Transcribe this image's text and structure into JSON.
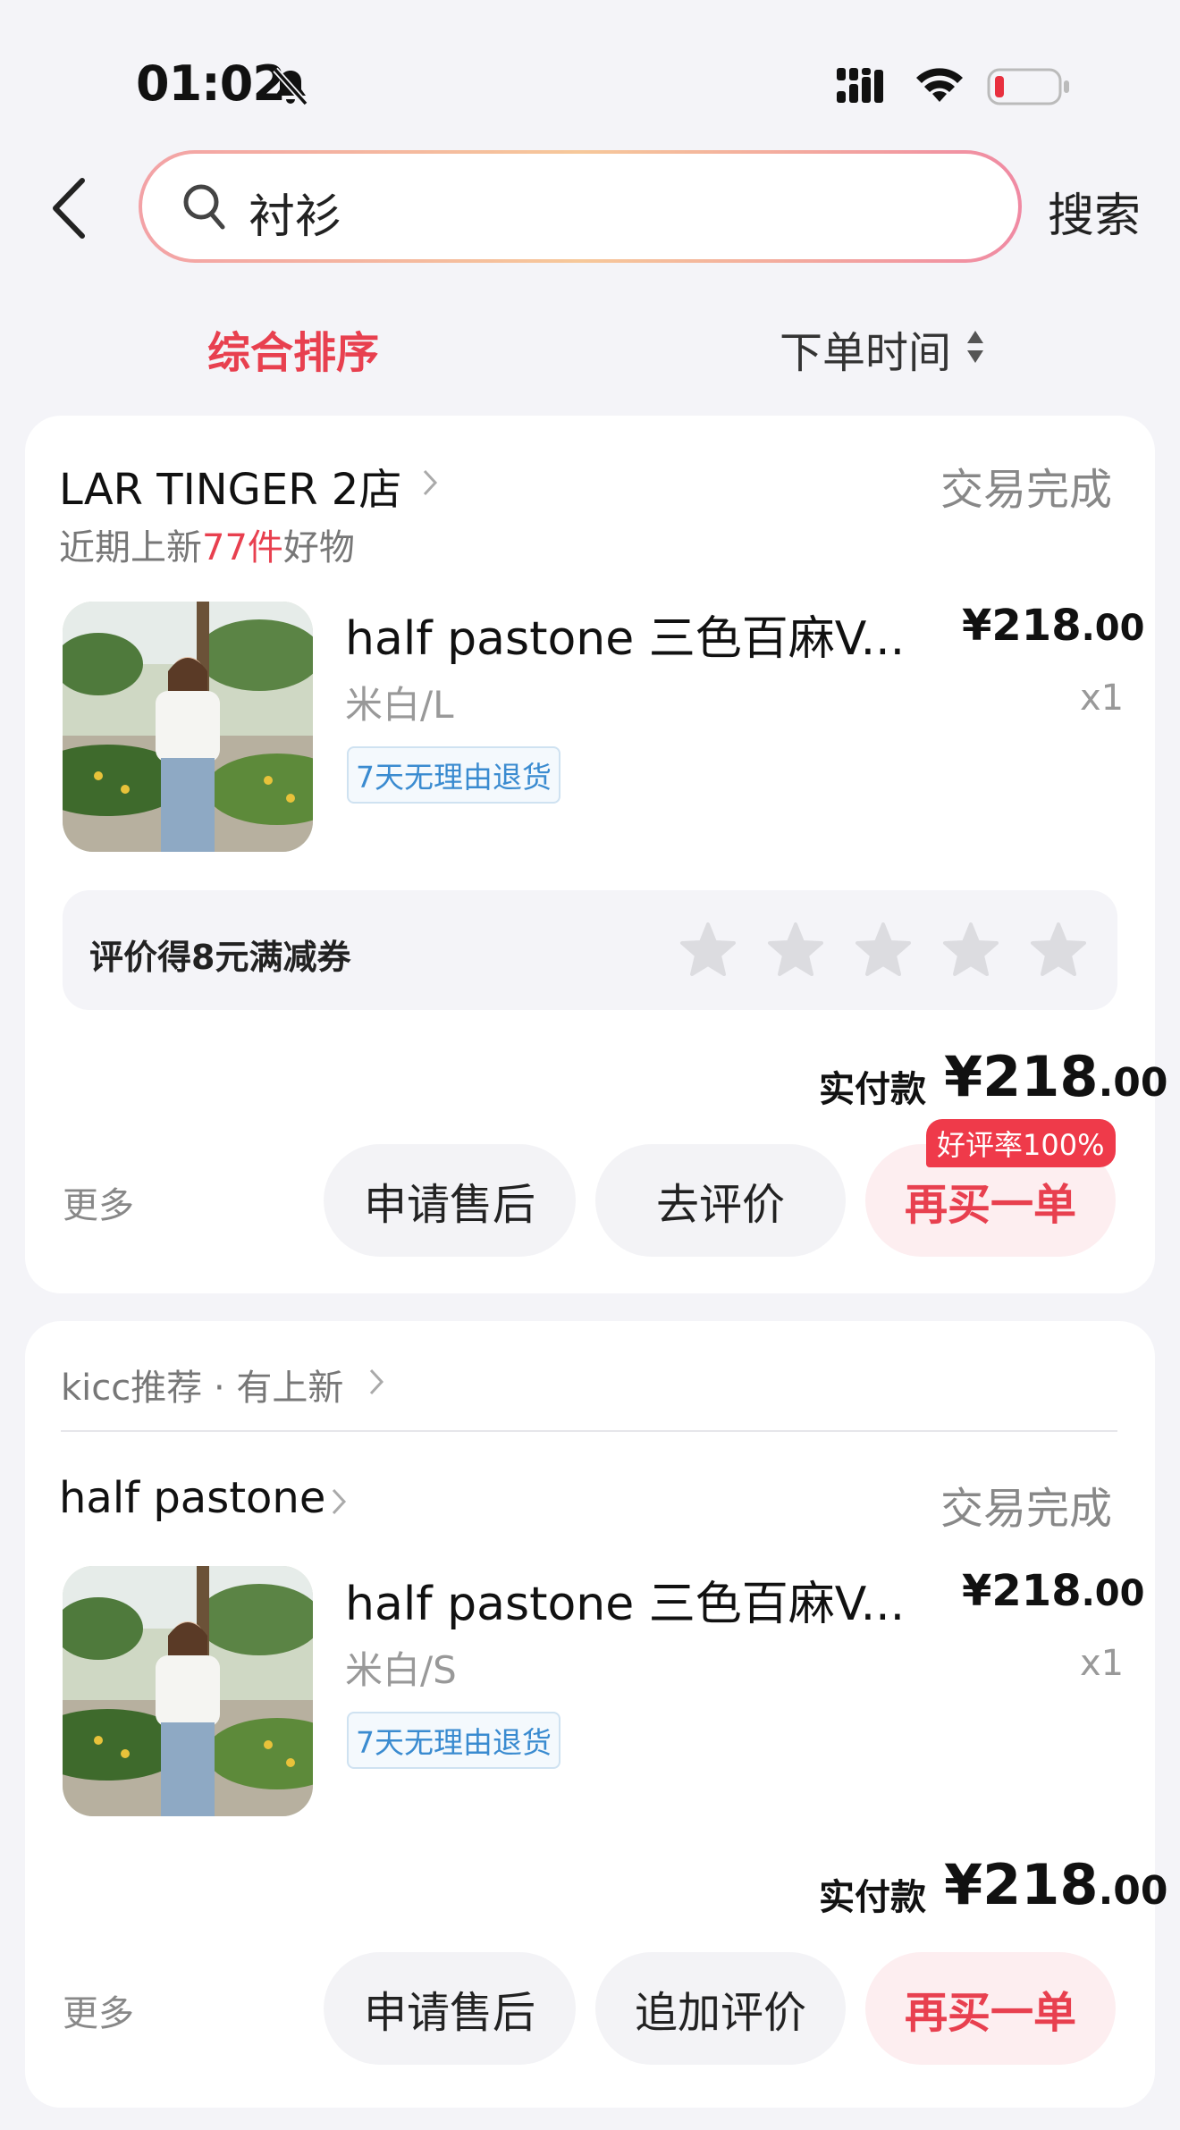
{
  "status_bar": {
    "time": "01:02"
  },
  "search": {
    "query": "衬衫",
    "button": "搜索"
  },
  "sort": {
    "active": "综合排序",
    "order_time": "下单时间"
  },
  "orders": [
    {
      "shop": "LAR TINGER 2店",
      "status": "交易完成",
      "sub_prefix": "近期上新",
      "sub_highlight": "77件",
      "sub_suffix": "好物",
      "product_title": "half pastone 三色百麻V...",
      "price_main": "¥218",
      "price_cents": ".00",
      "variant": "米白/L",
      "qty": "x1",
      "tag": "7天无理由退货",
      "review_prompt": "评价得8元满减券",
      "review_stars": 0,
      "paid_label": "实付款",
      "paid_main": "¥218",
      "paid_cents": ".00",
      "badge": "好评率100%",
      "more": "更多",
      "btn1": "申请售后",
      "btn2": "去评价",
      "btn3": "再买一单"
    },
    {
      "recommend": "kicc推荐 · 有上新",
      "shop": "half pastone",
      "status": "交易完成",
      "product_title": "half pastone 三色百麻V...",
      "price_main": "¥218",
      "price_cents": ".00",
      "variant": "米白/S",
      "qty": "x1",
      "tag": "7天无理由退货",
      "paid_label": "实付款",
      "paid_main": "¥218",
      "paid_cents": ".00",
      "more": "更多",
      "btn1": "申请售后",
      "btn2": "追加评价",
      "btn3": "再买一单"
    }
  ],
  "colors": {
    "accent": "#e8404f",
    "background": "#f4f4f8",
    "tag_blue": "#3a8bd0"
  }
}
